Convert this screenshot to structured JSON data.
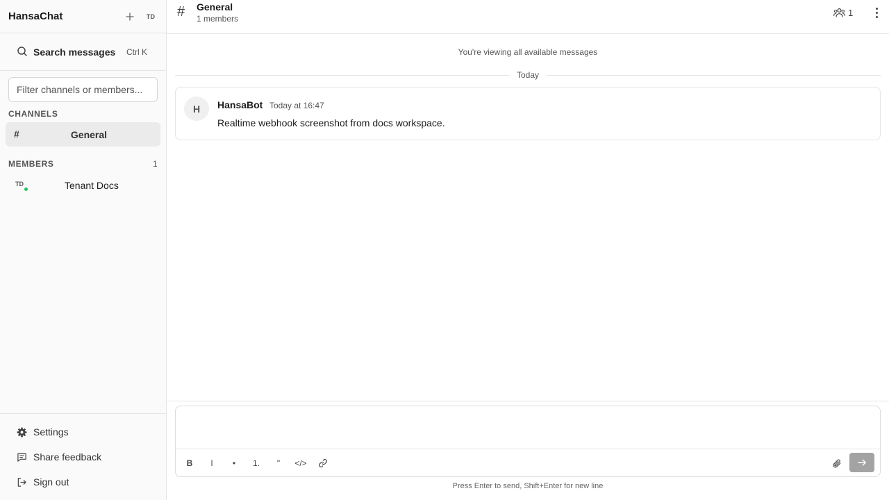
{
  "app": {
    "title": "HansaChat",
    "user_initials": "TD"
  },
  "search": {
    "label": "Search messages",
    "shortcut": "Ctrl K"
  },
  "filter": {
    "placeholder": "Filter channels or members..."
  },
  "channels": {
    "label": "CHANNELS",
    "items": [
      {
        "hash": "#",
        "name": "General",
        "active": true
      }
    ]
  },
  "members": {
    "label": "MEMBERS",
    "count": "1",
    "items": [
      {
        "initials": "TD",
        "name": "Tenant Docs",
        "online": true
      }
    ]
  },
  "footer": {
    "settings": "Settings",
    "feedback": "Share feedback",
    "signout": "Sign out"
  },
  "channel_header": {
    "hash": "#",
    "title": "General",
    "subtitle": "1 members",
    "members_count": "1"
  },
  "feed": {
    "note": "You're viewing all available messages",
    "day_divider": "Today",
    "messages": [
      {
        "avatar": "H",
        "author": "HansaBot",
        "time": "Today at 16:47",
        "text": "Realtime webhook screenshot from docs workspace."
      }
    ]
  },
  "composer": {
    "toolbar": {
      "bold": "B",
      "italic": "I",
      "bullet": "•",
      "numbered": "1.",
      "quote": "\"",
      "code": "</>"
    },
    "hint": "Press Enter to send, Shift+Enter for new line"
  },
  "colors": {
    "presence_online": "#22c55e",
    "send_disabled": "#a3a3a3",
    "active_channel_bg": "#ebebeb"
  }
}
